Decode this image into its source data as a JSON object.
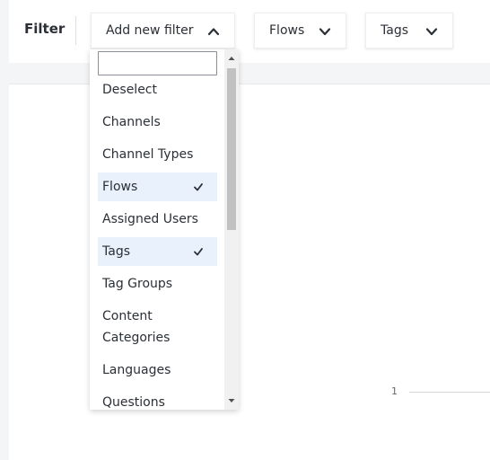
{
  "filter_bar": {
    "title": "Filter",
    "add_filter_label": "Add new filter",
    "flows_label": "Flows",
    "tags_label": "Tags"
  },
  "dropdown": {
    "search_value": "",
    "items": [
      {
        "label": "Deselect",
        "selected": false
      },
      {
        "label": "Channels",
        "selected": false
      },
      {
        "label": "Channel Types",
        "selected": false
      },
      {
        "label": "Flows",
        "selected": true
      },
      {
        "label": "Assigned Users",
        "selected": false
      },
      {
        "label": "Tags",
        "selected": true
      },
      {
        "label": "Tag Groups",
        "selected": false
      },
      {
        "label": "Content Categories",
        "selected": false
      },
      {
        "label": "Languages",
        "selected": false
      },
      {
        "label": "Questions",
        "selected": false
      }
    ],
    "selected_color": "#e8f1fc"
  },
  "chart": {
    "axis_tick": "1"
  }
}
